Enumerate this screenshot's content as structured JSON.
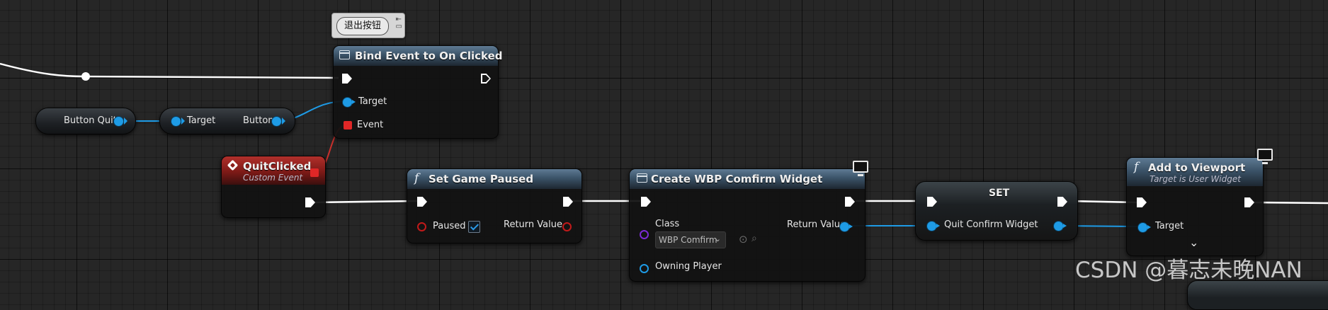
{
  "comment": {
    "text": "退出按钮"
  },
  "nodes": {
    "bind_event": {
      "title": "Bind Event to On Clicked",
      "pins": {
        "target": "Target",
        "event": "Event"
      }
    },
    "button_quit": {
      "label": "Button Quit"
    },
    "get_button": {
      "target": "Target",
      "output": "Button"
    },
    "quit_clicked": {
      "title": "QuitClicked",
      "subtitle": "Custom Event"
    },
    "set_game_paused": {
      "title": "Set Game Paused",
      "pins": {
        "paused": "Paused",
        "return_value": "Return Value"
      },
      "paused_checked": true
    },
    "create_widget": {
      "title": "Create WBP Comfirm Widget",
      "pins": {
        "class": "Class",
        "return_value": "Return Value",
        "owning_player": "Owning Player"
      },
      "class_value": "WBP Comfirm"
    },
    "set_var": {
      "title": "SET",
      "pin": "Quit Confirm Widget"
    },
    "add_to_viewport": {
      "title": "Add to Viewport",
      "subtitle": "Target is User Widget",
      "pin": "Target"
    }
  },
  "icons": {
    "function": "function-icon",
    "widget": "widget-icon",
    "event": "event-icon",
    "monitor": "monitor-icon"
  },
  "colors": {
    "exec_wire": "#ffffff",
    "object_wire": "#1e9be6",
    "delegate_wire": "#c9302c",
    "event_header": "#b1302b",
    "function_header": "#3b5368"
  },
  "watermark": "CSDN @暮志未晚NAN"
}
